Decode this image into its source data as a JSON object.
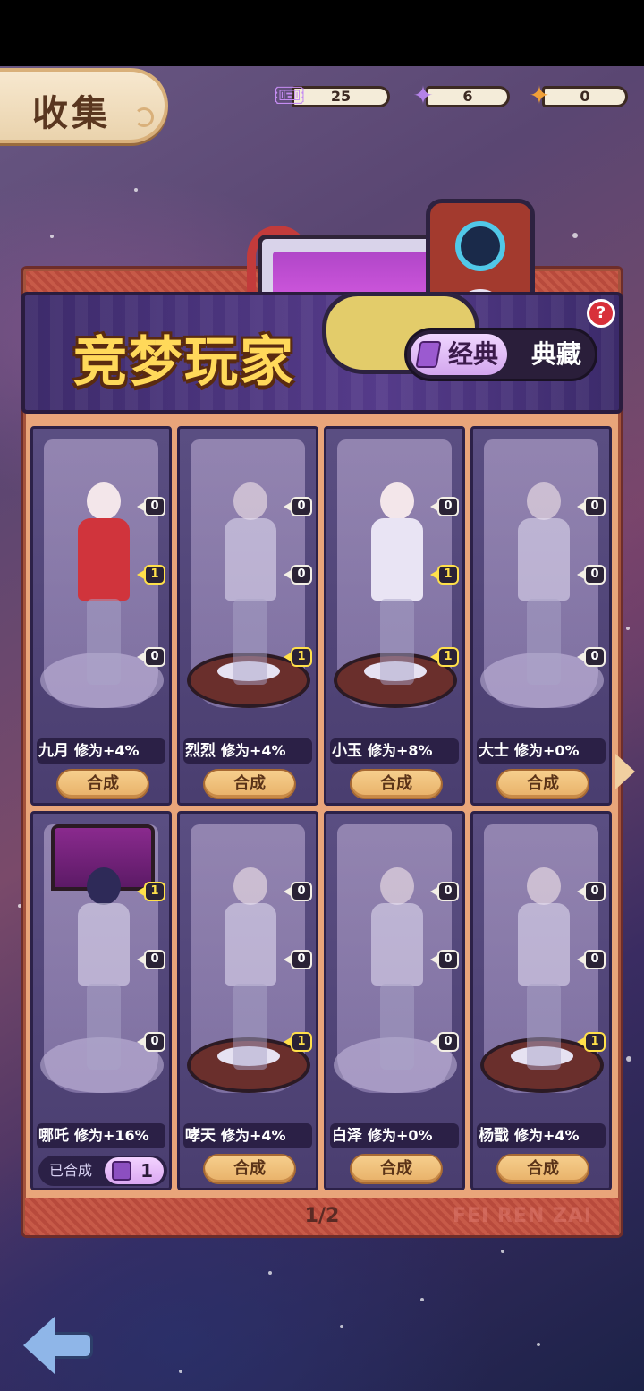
{
  "header": {
    "title": "收集"
  },
  "currencies": [
    {
      "icon": "ticket-icon",
      "value": "25"
    },
    {
      "icon": "purple-puzzle-icon",
      "value": "6"
    },
    {
      "icon": "orange-puzzle-icon",
      "value": "0"
    }
  ],
  "banner": {
    "title": "竞梦玩家",
    "tabs": [
      {
        "label": "经典",
        "active": true
      },
      {
        "label": "典藏",
        "active": false
      }
    ],
    "help": "?"
  },
  "cards": [
    {
      "name": "九月",
      "bonus": "修为+4%",
      "chips": [
        "0",
        "1",
        "0"
      ],
      "action": "合成"
    },
    {
      "name": "烈烈",
      "bonus": "修为+4%",
      "chips": [
        "0",
        "0",
        "1"
      ],
      "action": "合成"
    },
    {
      "name": "小玉",
      "bonus": "修为+8%",
      "chips": [
        "0",
        "1",
        "1"
      ],
      "action": "合成"
    },
    {
      "name": "大士",
      "bonus": "修为+0%",
      "chips": [
        "0",
        "0",
        "0"
      ],
      "action": "合成"
    },
    {
      "name": "哪吒",
      "bonus": "修为+16%",
      "chips": [
        "1",
        "0",
        "0"
      ],
      "status": "已合成",
      "piece_count": "1"
    },
    {
      "name": "哮天",
      "bonus": "修为+4%",
      "chips": [
        "0",
        "0",
        "1"
      ],
      "action": "合成"
    },
    {
      "name": "白泽",
      "bonus": "修为+0%",
      "chips": [
        "0",
        "0",
        "0"
      ],
      "action": "合成"
    },
    {
      "name": "杨戬",
      "bonus": "修为+4%",
      "chips": [
        "0",
        "0",
        "1"
      ],
      "action": "合成"
    }
  ],
  "pager": {
    "text": "1/2",
    "watermark": "FEI REN ZAI"
  }
}
